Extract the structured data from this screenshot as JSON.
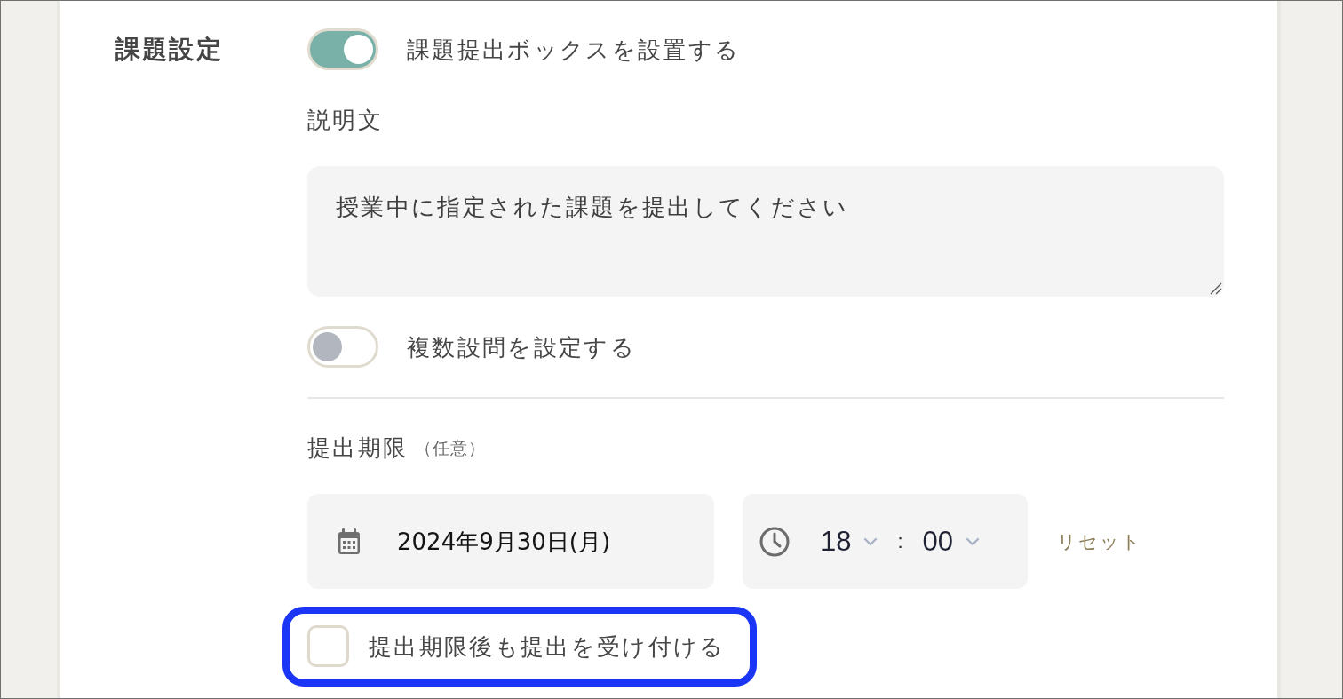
{
  "section": {
    "title": "課題設定"
  },
  "submission_box_toggle": {
    "label": "課題提出ボックスを設置する",
    "on": true
  },
  "description": {
    "label": "説明文",
    "value": "授業中に指定された課題を提出してください"
  },
  "multiple_questions_toggle": {
    "label": "複数設問を設定する",
    "on": false
  },
  "deadline": {
    "label": "提出期限",
    "note": "（任意）",
    "date": "2024年9月30日(月)",
    "hour": "18",
    "separator": ":",
    "minute": "00",
    "reset": "リセット"
  },
  "late_submission": {
    "label": "提出期限後も提出を受け付ける",
    "checked": false,
    "highlighted": true
  }
}
